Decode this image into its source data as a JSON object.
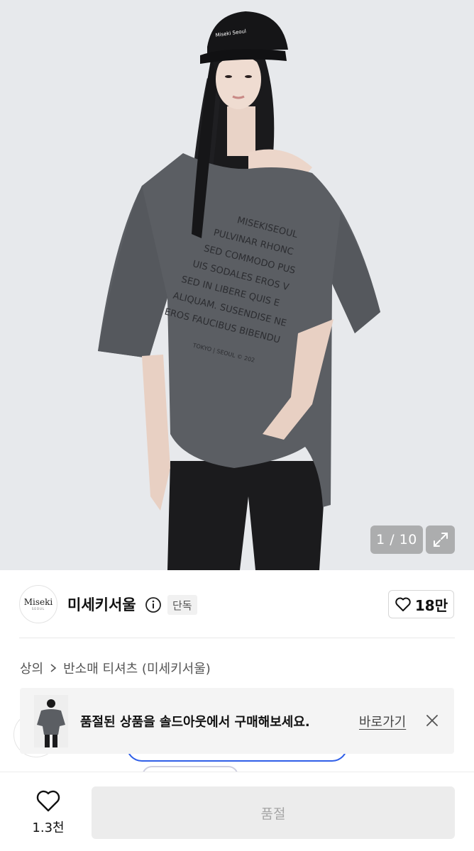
{
  "gallery": {
    "current": "1",
    "separator": "/",
    "total": "10",
    "counter_text": "1 / 10",
    "cap_text": "Miseki Seoul",
    "shirt_print_lines": [
      "MISEKISEOUL",
      "PULVINAR RHONC",
      "SED COMMODO PUS",
      "UIS SODALES EROS V",
      "SED IN LIBERE QUIS E",
      "ALIQUAM. SUSENDISE NE",
      "EROS FAUCIBUS BIBENDU"
    ],
    "shirt_print_footer": "TOKYO | SEOUL © 202"
  },
  "seller": {
    "logo_word": "Miseki",
    "logo_sub": "SEOUL",
    "name": "미세키서울",
    "badge": "단독",
    "like_count": "18만"
  },
  "breadcrumb": {
    "category": "상의",
    "subcategory": "반소매 티셔츠 (미세키서울)"
  },
  "soldout_banner": {
    "message": "품절된 상품을 솔드아웃에서 구매해보세요.",
    "link_label": "바로가기"
  },
  "bottom_bar": {
    "wish_count": "1.3천",
    "buy_button_label": "품절"
  },
  "colors": {
    "accent_blue": "#2f5fe8",
    "button_disabled_bg": "#ececec",
    "button_disabled_text": "#a6a6a6"
  },
  "icons": {
    "info": "info-circle-icon",
    "heart": "heart-outline-icon",
    "expand": "expand-arrows-icon",
    "close": "close-icon",
    "chevron": "chevron-right-icon"
  }
}
